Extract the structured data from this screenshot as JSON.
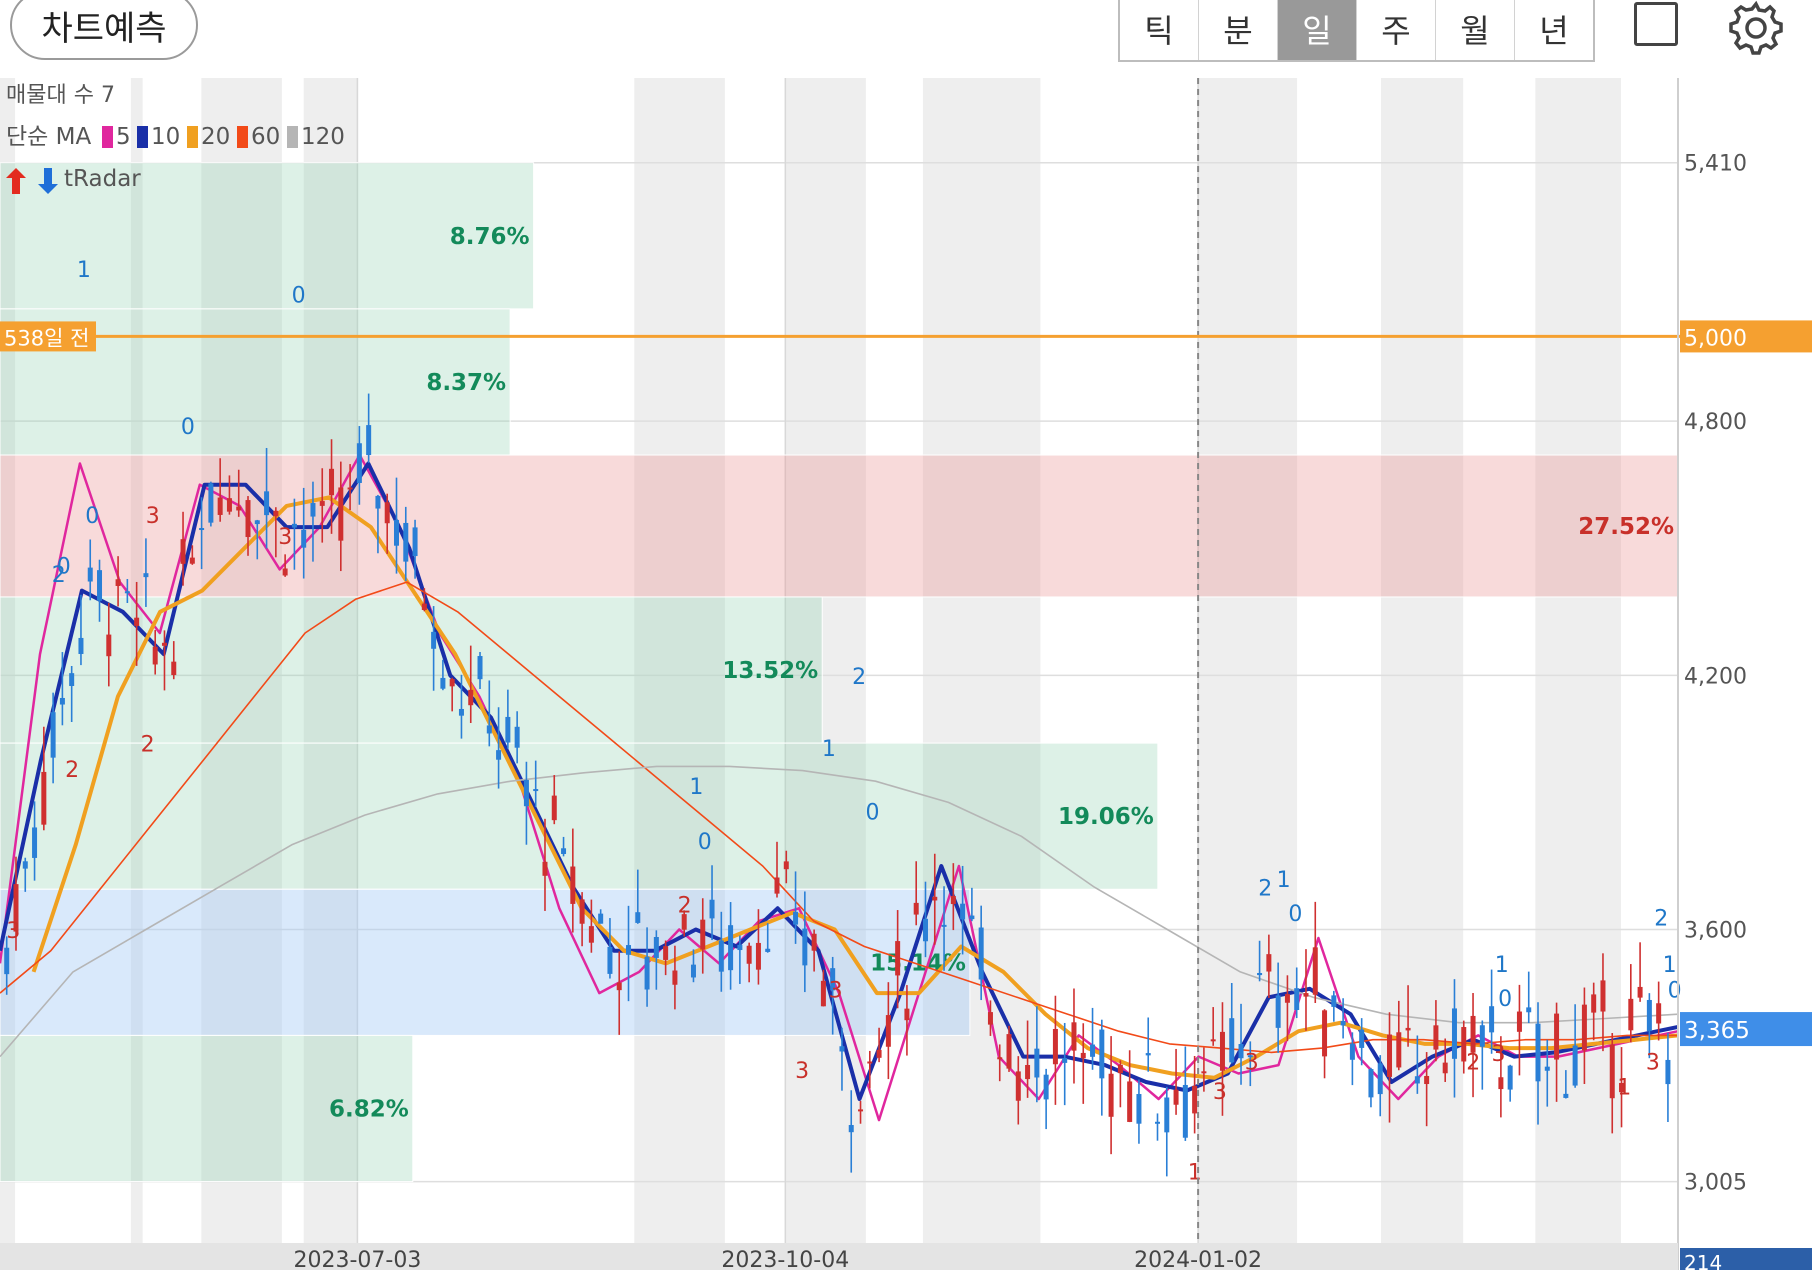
{
  "header": {
    "predict_label": "차트예측",
    "tabs": [
      {
        "label": "틱",
        "active": false
      },
      {
        "label": "분",
        "active": false
      },
      {
        "label": "일",
        "active": true
      },
      {
        "label": "주",
        "active": false
      },
      {
        "label": "월",
        "active": false
      },
      {
        "label": "년",
        "active": false
      }
    ],
    "icons": [
      "square-icon",
      "gear-icon"
    ]
  },
  "legend": {
    "volume_profile": "매물대 수 7",
    "ma_prefix": "단순 MA",
    "ma_items": [
      {
        "period": "5",
        "color": "#e0279e"
      },
      {
        "period": "10",
        "color": "#1a2fa8"
      },
      {
        "period": "20",
        "color": "#f0a020"
      },
      {
        "period": "60",
        "color": "#f24a18"
      },
      {
        "period": "120",
        "color": "#b5b5b5"
      }
    ],
    "radar_label": "tRadar"
  },
  "chart_data": {
    "type": "candlestick",
    "x_tick_labels": [
      "2023-07-03",
      "2023-10-04",
      "2024-01-02"
    ],
    "y_tick_labels": [
      "5,410",
      "5,000",
      "4,800",
      "4,200",
      "3,600",
      "3,365",
      "3,005"
    ],
    "ylim": [
      2860,
      5610
    ],
    "reference_line": {
      "label": "538일 전",
      "value": 5000,
      "value_label": "5,000",
      "color": "#f5a030"
    },
    "current_price": {
      "value": 3365,
      "label": "3,365",
      "color": "#3f8ee8"
    },
    "bottom_partial_label": "214",
    "zones": [
      {
        "label": "8.76%",
        "type": "green",
        "y_top": 5410,
        "y_bottom": 5065
      },
      {
        "label": "8.37%",
        "type": "green",
        "y_top": 5065,
        "y_bottom": 4720
      },
      {
        "label": "27.52%",
        "type": "red",
        "y_top": 4720,
        "y_bottom": 4385
      },
      {
        "label": "13.52%",
        "type": "green",
        "y_top": 4385,
        "y_bottom": 4040
      },
      {
        "label": "19.06%",
        "type": "green",
        "y_top": 4040,
        "y_bottom": 3695
      },
      {
        "label": "15.14%",
        "type": "blue",
        "y_top": 3695,
        "y_bottom": 3350
      },
      {
        "label": "6.82%",
        "type": "green",
        "y_top": 3350,
        "y_bottom": 3005
      }
    ],
    "moving_averages": [
      {
        "name": "5",
        "color": "#e0279e",
        "values": [
          3520,
          4250,
          4700,
          4420,
          4300,
          4650,
          4600,
          4450,
          4550,
          4720,
          4550,
          4300,
          4150,
          3950,
          3650,
          3450,
          3500,
          3600,
          3520,
          3620,
          3650,
          3450,
          3150,
          3450,
          3750,
          3300,
          3200,
          3350,
          3280,
          3200,
          3300,
          3260,
          3280,
          3580,
          3300,
          3200,
          3300,
          3350,
          3300,
          3300,
          3320,
          3340,
          3360
        ]
      },
      {
        "name": "10",
        "color": "#1a2fa8",
        "values": [
          3550,
          4000,
          4400,
          4350,
          4250,
          4650,
          4650,
          4550,
          4550,
          4700,
          4500,
          4200,
          4100,
          3900,
          3700,
          3550,
          3550,
          3600,
          3560,
          3650,
          3550,
          3200,
          3450,
          3750,
          3500,
          3300,
          3300,
          3280,
          3240,
          3220,
          3260,
          3440,
          3460,
          3400,
          3240,
          3300,
          3340,
          3300,
          3310,
          3330,
          3350,
          3370
        ]
      },
      {
        "name": "20",
        "color": "#f0a020",
        "values": [
          3500,
          3800,
          4150,
          4350,
          4400,
          4500,
          4600,
          4620,
          4550,
          4400,
          4250,
          4050,
          3850,
          3650,
          3550,
          3520,
          3560,
          3600,
          3640,
          3600,
          3450,
          3450,
          3560,
          3500,
          3400,
          3320,
          3280,
          3260,
          3250,
          3300,
          3360,
          3380,
          3350,
          3330,
          3330,
          3320,
          3320,
          3330,
          3340,
          3350
        ]
      },
      {
        "name": "60",
        "color": "#f24a18",
        "values": [
          3450,
          3550,
          3700,
          3850,
          4000,
          4150,
          4300,
          4380,
          4420,
          4350,
          4250,
          4150,
          4050,
          3950,
          3850,
          3750,
          3620,
          3560,
          3520,
          3480,
          3440,
          3400,
          3360,
          3330,
          3320,
          3310,
          3320,
          3340,
          3340,
          3330,
          3340,
          3340,
          3350,
          3350
        ]
      },
      {
        "name": "120",
        "color": "#b5b5b5",
        "values": [
          3300,
          3500,
          3600,
          3700,
          3800,
          3870,
          3920,
          3950,
          3970,
          3985,
          3985,
          3975,
          3950,
          3900,
          3820,
          3700,
          3600,
          3500,
          3440,
          3400,
          3380,
          3380,
          3390,
          3400
        ]
      }
    ],
    "signals": [
      {
        "text": "1",
        "color": "#1f77c8",
        "x": 0.05,
        "y": 5140
      },
      {
        "text": "2",
        "color": "#1f77c8",
        "x": 0.035,
        "y": 4420
      },
      {
        "text": "0",
        "color": "#1f77c8",
        "x": 0.055,
        "y": 4560
      },
      {
        "text": "0",
        "color": "#1f77c8",
        "x": 0.038,
        "y": 4440
      },
      {
        "text": "0",
        "color": "#1f77c8",
        "x": 0.112,
        "y": 4770
      },
      {
        "text": "0",
        "color": "#1f77c8",
        "x": 0.178,
        "y": 5080
      },
      {
        "text": "3",
        "color": "#c8302a",
        "x": 0.008,
        "y": 3580
      },
      {
        "text": "2",
        "color": "#c8302a",
        "x": 0.043,
        "y": 3960
      },
      {
        "text": "2",
        "color": "#c8302a",
        "x": 0.088,
        "y": 4020
      },
      {
        "text": "3",
        "color": "#c8302a",
        "x": 0.091,
        "y": 4560
      },
      {
        "text": "3",
        "color": "#c8302a",
        "x": 0.17,
        "y": 4510
      },
      {
        "text": "1",
        "color": "#1f77c8",
        "x": 0.415,
        "y": 3920
      },
      {
        "text": "0",
        "color": "#1f77c8",
        "x": 0.42,
        "y": 3790
      },
      {
        "text": "2",
        "color": "#c8302a",
        "x": 0.408,
        "y": 3640
      },
      {
        "text": "1",
        "color": "#1f77c8",
        "x": 0.494,
        "y": 4010
      },
      {
        "text": "2",
        "color": "#1f77c8",
        "x": 0.512,
        "y": 4180
      },
      {
        "text": "0",
        "color": "#1f77c8",
        "x": 0.52,
        "y": 3860
      },
      {
        "text": "3",
        "color": "#c8302a",
        "x": 0.478,
        "y": 3250
      },
      {
        "text": "3",
        "color": "#c8302a",
        "x": 0.498,
        "y": 3440
      },
      {
        "text": "1",
        "color": "#c8302a",
        "x": 0.712,
        "y": 3010
      },
      {
        "text": "3",
        "color": "#c8302a",
        "x": 0.727,
        "y": 3200
      },
      {
        "text": "3",
        "color": "#c8302a",
        "x": 0.746,
        "y": 3270
      },
      {
        "text": "2",
        "color": "#1f77c8",
        "x": 0.754,
        "y": 3680
      },
      {
        "text": "1",
        "color": "#1f77c8",
        "x": 0.765,
        "y": 3700
      },
      {
        "text": "0",
        "color": "#1f77c8",
        "x": 0.772,
        "y": 3620
      },
      {
        "text": "1",
        "color": "#1f77c8",
        "x": 0.895,
        "y": 3500
      },
      {
        "text": "0",
        "color": "#1f77c8",
        "x": 0.897,
        "y": 3420
      },
      {
        "text": "2",
        "color": "#c8302a",
        "x": 0.878,
        "y": 3270
      },
      {
        "text": "3",
        "color": "#c8302a",
        "x": 0.893,
        "y": 3290
      },
      {
        "text": "1",
        "color": "#c8302a",
        "x": 0.968,
        "y": 3210
      },
      {
        "text": "3",
        "color": "#c8302a",
        "x": 0.985,
        "y": 3270
      },
      {
        "text": "2",
        "color": "#1f77c8",
        "x": 0.99,
        "y": 3610
      },
      {
        "text": "1",
        "color": "#1f77c8",
        "x": 0.995,
        "y": 3500
      },
      {
        "text": "0",
        "color": "#1f77c8",
        "x": 0.998,
        "y": 3440
      }
    ]
  }
}
